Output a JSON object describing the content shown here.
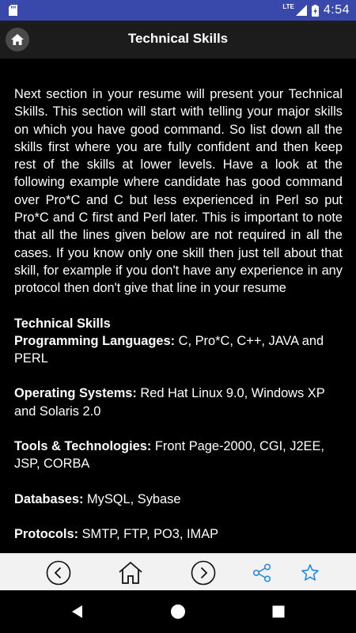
{
  "status_bar": {
    "network": "LTE",
    "time": "4:54"
  },
  "app_bar": {
    "title": "Technical Skills",
    "home_icon": "home-icon"
  },
  "content": {
    "intro": "Next section in your resume will present your Technical Skills. This section will start with telling your major skills on which you have good command. So list down all the skills first where you are fully confident and then keep rest of the skills at lower levels. Have a look at the following example where candidate has good command over Pro*C and C but less experienced in Perl so put Pro*C and C first and Perl later. This is important to note that all the lines given below are not required in all the cases. If you know only one skill then just tell about that skill, for example if you don't have any experience in any protocol then don't give that line in your resume",
    "section_title": "Technical Skills",
    "skills": [
      {
        "label": "Programming Languages:",
        "value": " C, Pro*C, C++, JAVA and PERL"
      },
      {
        "label": "Operating Systems:",
        "value": " Red Hat Linux 9.0, Windows XP and Solaris 2.0"
      },
      {
        "label": "Tools & Technologies:",
        "value": " Front Page-2000, CGI, J2EE, JSP, CORBA"
      },
      {
        "label": "Databases:",
        "value": " MySQL, Sybase"
      },
      {
        "label": "Protocols:",
        "value": " SMTP, FTP, PO3, IMAP"
      }
    ]
  },
  "bottom_bar": {
    "icons": [
      "chevron-left-circle-icon",
      "home-outline-icon",
      "chevron-right-circle-icon",
      "share-icon",
      "star-icon"
    ],
    "accent": "#1e88e5"
  },
  "nav_bar": {
    "icons": [
      "back-triangle-icon",
      "home-circle-icon",
      "recents-square-icon"
    ]
  }
}
